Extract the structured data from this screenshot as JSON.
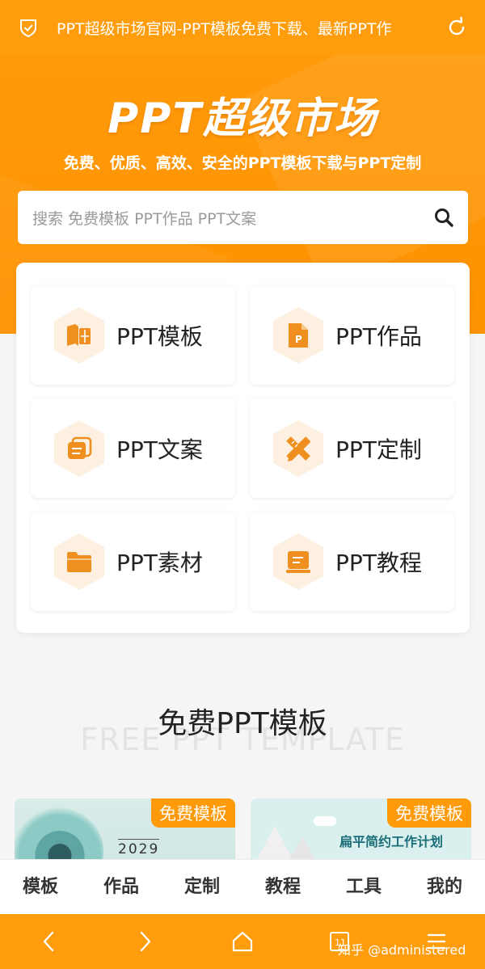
{
  "browser": {
    "url_title": "PPT超级市场官网-PPT模板免费下载、最新PPT作",
    "shield_icon": "shield-check-icon",
    "refresh_icon": "refresh-icon"
  },
  "hero": {
    "logo_text": "PPT超级市场",
    "slogan": "免费、优质、高效、安全的PPT模板下载与PPT定制",
    "search_placeholder": "搜索 免费模板 PPT作品 PPT文案"
  },
  "categories": [
    {
      "label": "PPT模板",
      "icon": "book-icon"
    },
    {
      "label": "PPT作品",
      "icon": "ppt-file-icon"
    },
    {
      "label": "PPT文案",
      "icon": "documents-icon"
    },
    {
      "label": "PPT定制",
      "icon": "pencil-ruler-icon"
    },
    {
      "label": "PPT素材",
      "icon": "folder-icon"
    },
    {
      "label": "PPT教程",
      "icon": "tutorial-icon"
    }
  ],
  "section": {
    "title": "免费PPT模板",
    "subtitle": "FREE PPT TEMPLATE"
  },
  "templates": [
    {
      "badge": "免费模板",
      "year": "2029"
    },
    {
      "badge": "免费模板",
      "title": "扁平简约工作计划"
    }
  ],
  "bottom_nav": [
    "模板",
    "作品",
    "定制",
    "教程",
    "工具",
    "我的"
  ],
  "toolbar": {
    "tab_count": "11",
    "watermark": "知乎 @administered"
  },
  "colors": {
    "brand_orange": "#ff9d0d",
    "icon_orange": "#ee8f1f",
    "icon_bg": "#fdf0e0"
  }
}
